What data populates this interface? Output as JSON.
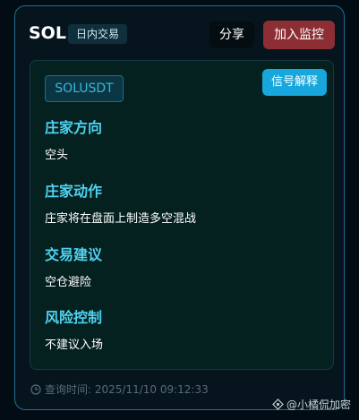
{
  "header": {
    "symbol": "SOL",
    "trade_type": "日内交易",
    "share_label": "分享",
    "monitor_label": "加入监控"
  },
  "panel": {
    "pair": "SOLUSDT",
    "signal_button": "信号解释",
    "sections": [
      {
        "title": "庄家方向",
        "value": "空头"
      },
      {
        "title": "庄家动作",
        "value": "庄家将在盘面上制造多空混战"
      },
      {
        "title": "交易建议",
        "value": "空仓避险"
      },
      {
        "title": "风险控制",
        "value": "不建议入场"
      }
    ]
  },
  "footer": {
    "query_time": "查询时间: 2025/11/10 09:12:33"
  },
  "watermark": {
    "text": "@小橘侃加密"
  },
  "colors": {
    "accent": "#17a7dc",
    "monitor": "#8c2e33",
    "section_title": "#4fd2f0"
  },
  "icons": [
    "clock-icon",
    "watermark-icon"
  ]
}
